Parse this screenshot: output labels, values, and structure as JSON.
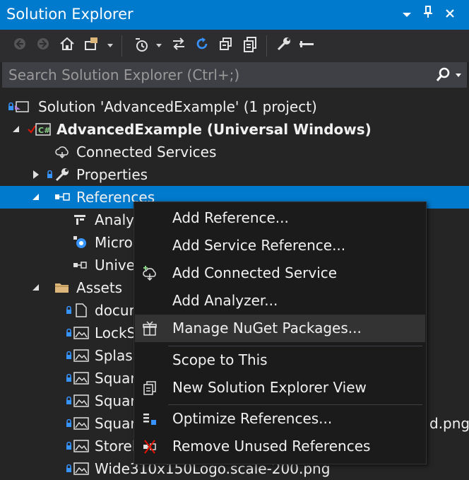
{
  "window": {
    "title": "Solution Explorer",
    "buttons": [
      "dropdown",
      "pin",
      "close"
    ]
  },
  "toolbar": {
    "tools": [
      "back-icon",
      "forward-icon",
      "home-icon",
      "switch-views-icon",
      "pending-changes-filter-icon",
      "sync-icon",
      "refresh-icon",
      "collapse-all-icon",
      "show-all-files-icon",
      "properties-icon",
      "preview-icon"
    ]
  },
  "search": {
    "placeholder": "Search Solution Explorer (Ctrl+;)",
    "value": ""
  },
  "tree": {
    "solution": "Solution 'AdvancedExample' (1 project)",
    "project": "AdvancedExample (Universal Windows)",
    "connected_services": "Connected Services",
    "properties": "Properties",
    "references": "References",
    "ref_analyzers": "Analy",
    "ref_microsoft": "Micro",
    "ref_universal": "Unive",
    "assets": "Assets",
    "asset_doc": "docur",
    "asset_lockscreen": "LockS",
    "asset_splash": "Splasl",
    "asset_square1": "Squar",
    "asset_square2": "Squar",
    "asset_square3": "Squar",
    "asset_square3_suffix": "d.png",
    "asset_store": "Storel",
    "asset_wide": "Wide310x150Logo.scale-200.png"
  },
  "context_menu": {
    "add_reference": "Add Reference...",
    "add_service_reference": "Add Service Reference...",
    "add_connected_service": "Add Connected Service",
    "add_analyzer": "Add Analyzer...",
    "manage_nuget": "Manage NuGet Packages...",
    "scope_to_this": "Scope to This",
    "new_view": "New Solution Explorer View",
    "optimize_references": "Optimize References...",
    "remove_unused": "Remove Unused References"
  },
  "colors": {
    "accent": "#007acc",
    "background": "#252526",
    "menu_background": "#1b1b1c",
    "menu_hover": "#333334"
  }
}
